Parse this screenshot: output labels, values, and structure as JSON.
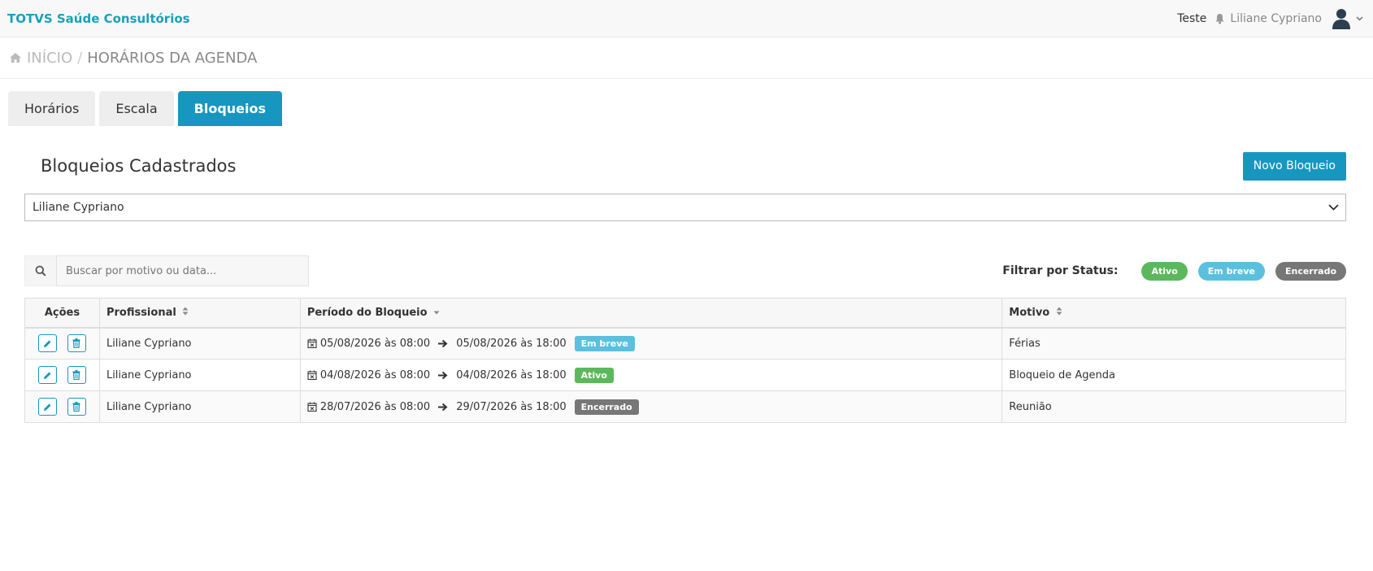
{
  "app": {
    "brand": "TOTVS Saúde Consultórios"
  },
  "topbar": {
    "link": "Teste",
    "user_name": "Liliane Cypriano"
  },
  "breadcrumb": {
    "home": "INÍCIO",
    "separator": "/",
    "current": "HORÁRIOS DA AGENDA"
  },
  "tabs": [
    {
      "label": "Horários",
      "active": false
    },
    {
      "label": "Escala",
      "active": false
    },
    {
      "label": "Bloqueios",
      "active": true
    }
  ],
  "panel": {
    "title": "Bloqueios Cadastrados",
    "new_button": "Novo Bloqueio",
    "professional_select": "Liliane Cypriano"
  },
  "search": {
    "placeholder": "Buscar por motivo ou data..."
  },
  "status_filter": {
    "label": "Filtrar por Status:",
    "options": [
      {
        "label": "Ativo",
        "color": "#5cb85c"
      },
      {
        "label": "Em breve",
        "color": "#5bc0de"
      },
      {
        "label": "Encerrado",
        "color": "#777777"
      }
    ]
  },
  "table": {
    "headers": {
      "actions": "Ações",
      "professional": "Profissional",
      "period": "Período do Bloqueio",
      "reason": "Motivo"
    },
    "rows": [
      {
        "professional": "Liliane Cypriano",
        "start": "05/08/2026 às 08:00",
        "end": "05/08/2026 às 18:00",
        "status": "Em breve",
        "status_color": "#5bc0de",
        "reason": "Férias"
      },
      {
        "professional": "Liliane Cypriano",
        "start": "04/08/2026 às 08:00",
        "end": "04/08/2026 às 18:00",
        "status": "Ativo",
        "status_color": "#5cb85c",
        "reason": "Bloqueio de Agenda"
      },
      {
        "professional": "Liliane Cypriano",
        "start": "28/07/2026 às 08:00",
        "end": "29/07/2026 às 18:00",
        "status": "Encerrado",
        "status_color": "#777777",
        "reason": "Reunião"
      }
    ]
  },
  "colors": {
    "accent": "#1797bf",
    "brand_text": "#17a2b8"
  }
}
